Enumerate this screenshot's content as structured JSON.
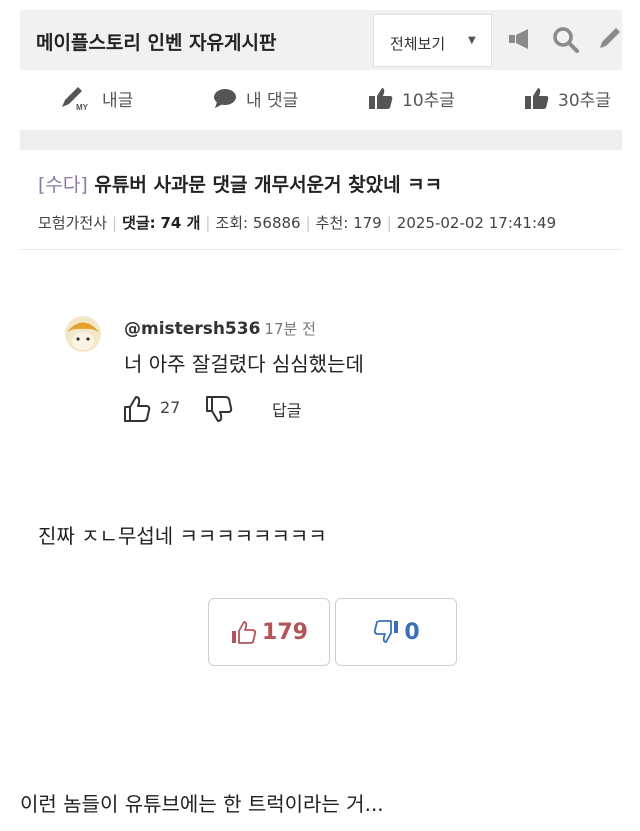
{
  "header": {
    "board_title": "메이플스토리 인벤 자유게시판",
    "view_select": {
      "label": "전체보기",
      "caret": "▼"
    },
    "icons": [
      "megaphone-icon",
      "search-icon",
      "pencil-icon"
    ]
  },
  "my_menu": {
    "my_posts": "내글",
    "my_comments": "내 댓글",
    "top10": "10추글",
    "top30": "30추글",
    "my_badge": "MY"
  },
  "post": {
    "category": "[수다]",
    "title": "유튜버 사과문 댓글 개무서운거 찾았네 ㅋㅋ",
    "author": "모험가전사",
    "comments_label": "댓글:",
    "comments_value": "74 개",
    "views_label": "조회:",
    "views_value": "56886",
    "recommend_label": "추천:",
    "recommend_value": "179",
    "datetime": "2025-02-02 17:41:49"
  },
  "embedded_comment": {
    "handle": "@mistersh536",
    "time_ago": "17분 전",
    "text": "너 아주 잘걸렸다 심심했는데",
    "like_count": "27",
    "reply_label": "답글"
  },
  "body": {
    "line1": "진짜 ㅈㄴ무섭네 ㅋㅋㅋㅋㅋㅋㅋㅋ",
    "line2": "이런 놈들이 유튜브에는 한 트럭이라는 거..."
  },
  "votes": {
    "up_count": "179",
    "down_count": "0",
    "up_color": "#b4545a",
    "down_color": "#3a70b8"
  }
}
